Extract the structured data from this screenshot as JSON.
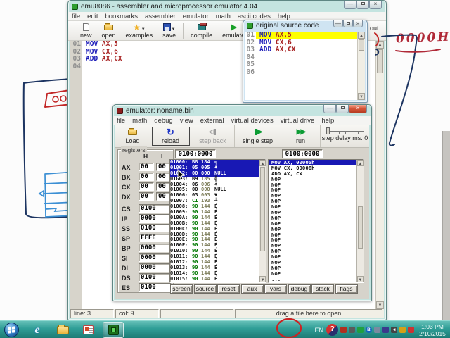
{
  "colors": {
    "taskbar_teal": "#2f9d96",
    "selection_blue": "#1818b4",
    "highlight_yellow": "#ffff00",
    "opcode_blue": "#1a1ab8",
    "operand_red": "#a82222",
    "byte_green": "#007800"
  },
  "annotations": {
    "hand_note": "0000H"
  },
  "main_window": {
    "title": "emu8086 - assembler and microprocessor emulator 4.04",
    "menu": [
      "file",
      "edit",
      "bookmarks",
      "assembler",
      "emulator",
      "math",
      "ascii codes",
      "help"
    ],
    "toolbar": {
      "new": "new",
      "open": "open",
      "examples": "examples",
      "save": "save",
      "compile": "compile",
      "emulate": "emulate",
      "partial": "out"
    },
    "editor_lines": [
      {
        "num": "01",
        "op": "MOV",
        "args": "AX,5"
      },
      {
        "num": "02",
        "op": "MOV",
        "args": "CX,6"
      },
      {
        "num": "03",
        "op": "ADD",
        "args": "AX,CX"
      },
      {
        "num": "04",
        "op": "",
        "args": ""
      }
    ],
    "status": {
      "line": "line: 3",
      "col": "col: 9",
      "hint": "drag a file here to open"
    }
  },
  "source_window": {
    "title": "original source code",
    "lines": [
      {
        "num": "01",
        "op": "MOV",
        "args": "AX,5",
        "hl": true
      },
      {
        "num": "02",
        "op": "MOV",
        "args": "CX,6",
        "hl": false
      },
      {
        "num": "03",
        "op": "ADD",
        "args": "AX,CX",
        "hl": false
      },
      {
        "num": "04",
        "op": "",
        "args": "",
        "hl": false
      },
      {
        "num": "05",
        "op": "",
        "args": "",
        "hl": false
      },
      {
        "num": "06",
        "op": "",
        "args": "",
        "hl": false
      }
    ]
  },
  "emulator_window": {
    "title": "emulator: noname.bin",
    "menu": [
      "file",
      "math",
      "debug",
      "view",
      "external",
      "virtual devices",
      "virtual drive",
      "help"
    ],
    "toolbar": {
      "load": "Load",
      "reload": "reload",
      "step_back": "step back",
      "single_step": "single step",
      "run": "run",
      "delay": "step delay ms: 0"
    },
    "registers": {
      "label": "registers",
      "col_h": "H",
      "col_l": "L",
      "pairs": [
        [
          "AX",
          "00",
          "00"
        ],
        [
          "BX",
          "00",
          "00"
        ],
        [
          "CX",
          "00",
          "00"
        ],
        [
          "DX",
          "00",
          "00"
        ]
      ],
      "singles": [
        [
          "CS",
          "0100"
        ],
        [
          "IP",
          "0000"
        ],
        [
          "SS",
          "0100"
        ],
        [
          "SP",
          "FFFE"
        ],
        [
          "BP",
          "0000"
        ],
        [
          "SI",
          "0000"
        ],
        [
          "DI",
          "0000"
        ],
        [
          "DS",
          "0100"
        ],
        [
          "ES",
          "0100"
        ]
      ]
    },
    "memory": {
      "header": "0100:0000",
      "rows": [
        {
          "a": "01000:",
          "h": "B8",
          "d": "184",
          "c": "╕",
          "sel": true,
          "g": false
        },
        {
          "a": "01001:",
          "h": "05",
          "d": "005",
          "c": "♣",
          "sel": true,
          "g": false
        },
        {
          "a": "01002:",
          "h": "00",
          "d": "000",
          "c": "NULL",
          "sel": true,
          "g": false
        },
        {
          "a": "01003:",
          "h": "B9",
          "d": "185",
          "c": "╣",
          "sel": false,
          "g": false
        },
        {
          "a": "01004:",
          "h": "06",
          "d": "006",
          "c": "♠",
          "sel": false,
          "g": false
        },
        {
          "a": "01005:",
          "h": "00",
          "d": "000",
          "c": "NULL",
          "sel": false,
          "g": false
        },
        {
          "a": "01006:",
          "h": "03",
          "d": "003",
          "c": "♥",
          "sel": false,
          "g": false
        },
        {
          "a": "01007:",
          "h": "C1",
          "d": "193",
          "c": "┴",
          "sel": false,
          "g": true
        },
        {
          "a": "01008:",
          "h": "90",
          "d": "144",
          "c": "É",
          "sel": false,
          "g": true
        },
        {
          "a": "01009:",
          "h": "90",
          "d": "144",
          "c": "É",
          "sel": false,
          "g": true
        },
        {
          "a": "0100A:",
          "h": "90",
          "d": "144",
          "c": "É",
          "sel": false,
          "g": true
        },
        {
          "a": "0100B:",
          "h": "90",
          "d": "144",
          "c": "É",
          "sel": false,
          "g": true
        },
        {
          "a": "0100C:",
          "h": "90",
          "d": "144",
          "c": "É",
          "sel": false,
          "g": true
        },
        {
          "a": "0100D:",
          "h": "90",
          "d": "144",
          "c": "É",
          "sel": false,
          "g": true
        },
        {
          "a": "0100E:",
          "h": "90",
          "d": "144",
          "c": "É",
          "sel": false,
          "g": true
        },
        {
          "a": "0100F:",
          "h": "90",
          "d": "144",
          "c": "É",
          "sel": false,
          "g": true
        },
        {
          "a": "01010:",
          "h": "90",
          "d": "144",
          "c": "É",
          "sel": false,
          "g": true
        },
        {
          "a": "01011:",
          "h": "90",
          "d": "144",
          "c": "É",
          "sel": false,
          "g": true
        },
        {
          "a": "01012:",
          "h": "90",
          "d": "144",
          "c": "É",
          "sel": false,
          "g": true
        },
        {
          "a": "01013:",
          "h": "90",
          "d": "144",
          "c": "É",
          "sel": false,
          "g": true
        },
        {
          "a": "01014:",
          "h": "90",
          "d": "144",
          "c": "É",
          "sel": false,
          "g": true
        },
        {
          "a": "01015:",
          "h": "90",
          "d": "144",
          "c": "É",
          "sel": false,
          "g": true
        }
      ]
    },
    "disasm": {
      "header": "0100:0000",
      "rows": [
        {
          "t": "MOV AX, 00005h",
          "sel": true
        },
        {
          "t": "MOV CX, 00006h",
          "sel": false
        },
        {
          "t": "ADD AX, CX",
          "sel": false
        },
        {
          "t": "NOP",
          "sel": false
        },
        {
          "t": "NOP",
          "sel": false
        },
        {
          "t": "NOP",
          "sel": false
        },
        {
          "t": "NOP",
          "sel": false
        },
        {
          "t": "NOP",
          "sel": false
        },
        {
          "t": "NOP",
          "sel": false
        },
        {
          "t": "NOP",
          "sel": false
        },
        {
          "t": "NOP",
          "sel": false
        },
        {
          "t": "NOP",
          "sel": false
        },
        {
          "t": "NOP",
          "sel": false
        },
        {
          "t": "NOP",
          "sel": false
        },
        {
          "t": "NOP",
          "sel": false
        },
        {
          "t": "NOP",
          "sel": false
        },
        {
          "t": "NOP",
          "sel": false
        },
        {
          "t": "NOP",
          "sel": false
        },
        {
          "t": "NOP",
          "sel": false
        },
        {
          "t": "NOP",
          "sel": false
        },
        {
          "t": "NOP",
          "sel": false
        },
        {
          "t": "...",
          "sel": false
        }
      ]
    },
    "buttons": [
      "screen",
      "source",
      "reset",
      "aux",
      "vars",
      "debug",
      "stack",
      "flags"
    ]
  },
  "taskbar": {
    "lang": "EN",
    "time": "1:03 PM",
    "date": "2/10/2015"
  }
}
